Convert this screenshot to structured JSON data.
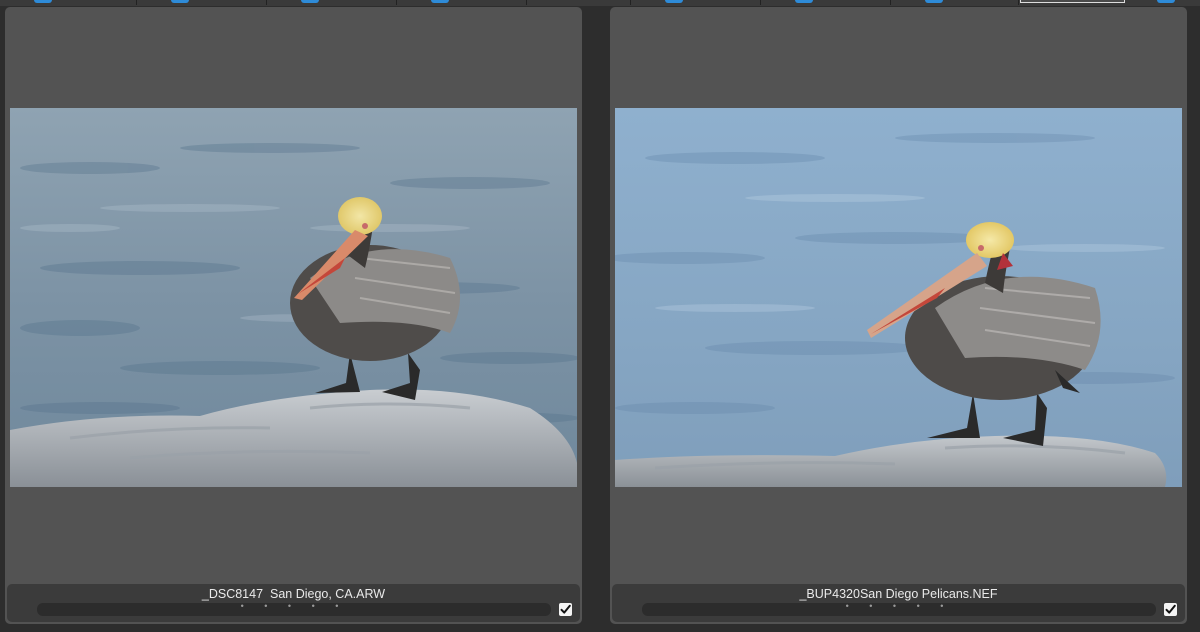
{
  "colors": {
    "background": "#2d2d2d",
    "panel": "#535353",
    "caption_bar": "#3b3b3b",
    "top_tab_icon": "#2e8bd8"
  },
  "panels": [
    {
      "caption": "_DSC8147  San Diego, CA.ARW",
      "rating_dots": "• • • • •",
      "selected": true,
      "image": "brown-pelican-on-rock-left"
    },
    {
      "caption": "_BUP4320San Diego Pelicans.NEF",
      "rating_dots": "• • • • •",
      "selected": true,
      "image": "brown-pelican-on-rock-right"
    }
  ],
  "icons": {
    "checkbox": "checkmark-icon",
    "top_tab": "tab-icon"
  }
}
